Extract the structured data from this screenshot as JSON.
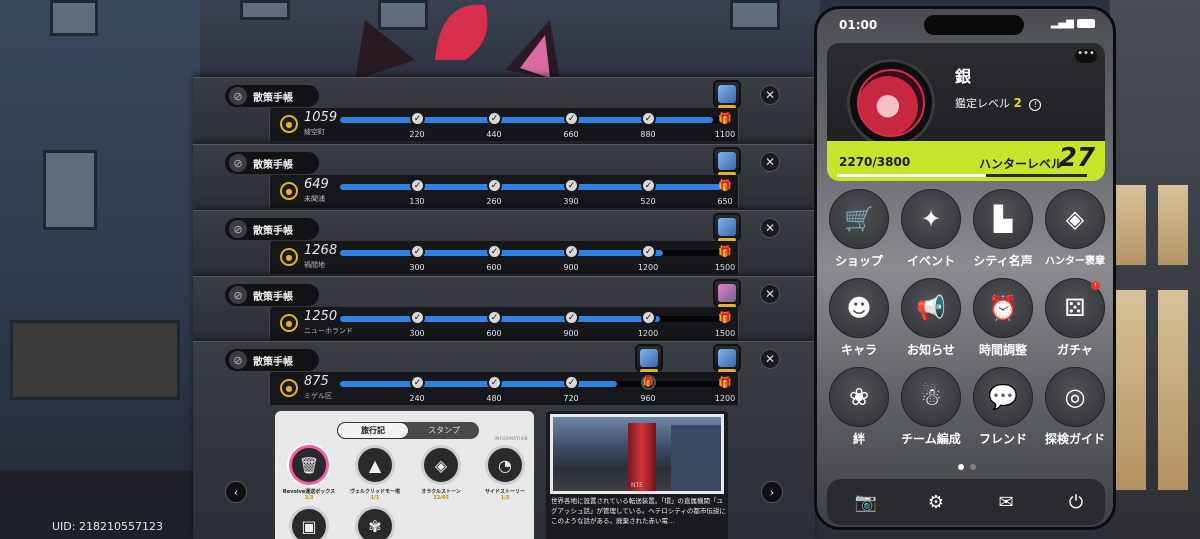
{
  "uid": "UID: 218210557123",
  "cards": [
    {
      "tag": "散策手帳",
      "score": "1059",
      "district": "綾空町",
      "fill_fraction": 0.97,
      "milestones": [
        "220",
        "440",
        "660",
        "880",
        "1100"
      ],
      "reward_tint": "blue"
    },
    {
      "tag": "散策手帳",
      "score": "649",
      "district": "未聞浦",
      "fill_fraction": 0.99,
      "milestones": [
        "130",
        "260",
        "390",
        "520",
        "650"
      ],
      "reward_tint": "blue"
    },
    {
      "tag": "散策手帳",
      "score": "1268",
      "district": "禍間地",
      "fill_fraction": 0.84,
      "milestones": [
        "300",
        "600",
        "900",
        "1200",
        "1500"
      ],
      "reward_tint": "blue"
    },
    {
      "tag": "散策手帳",
      "score": "1250",
      "district": "ニューホランド",
      "fill_fraction": 0.83,
      "milestones": [
        "300",
        "600",
        "900",
        "1200",
        "1500"
      ],
      "reward_tint": "pink"
    },
    {
      "tag": "散策手帳",
      "score": "875",
      "district": "ミゲル区",
      "fill_fraction": 0.72,
      "milestones": [
        "240",
        "480",
        "720",
        "960",
        "1200"
      ],
      "reward_tint": "blue"
    }
  ],
  "info": {
    "tabs": [
      "旅行記",
      "スタンプ"
    ],
    "active_tab": 0,
    "corner_tag": "INFORMATION",
    "stamps": [
      {
        "name": "Revolve運送ボックス",
        "count": "3/3",
        "icon": "trash-can-icon",
        "selected": true
      },
      {
        "name": "ヴェルクリッドモー塔",
        "count": "1/1",
        "icon": "tower-icon",
        "selected": false
      },
      {
        "name": "オラクルストーン",
        "count": "32/45",
        "icon": "crystal-icon",
        "selected": false
      },
      {
        "name": "サイドストーリー",
        "count": "1/3",
        "icon": "clock-spiral-icon",
        "selected": false
      },
      {
        "name": "",
        "count": "",
        "icon": "box-icon",
        "selected": false
      },
      {
        "name": "",
        "count": "",
        "icon": "knot-icon",
        "selected": false
      }
    ],
    "photo_caption": "NTE",
    "description": "世界各地に設置されている転送装置。「環」の直属機関「ユグアッシュ話」が管理している。ヘテロシティの都市伝説にこのような話がある。廃棄された赤い電…"
  },
  "phone": {
    "time": "01:00",
    "more": "•••",
    "player_name": "銀",
    "appraise_label": "鑑定レベル",
    "appraise_level": "2",
    "exp_text": "2270/3800",
    "exp_fraction": 0.597,
    "hunter_label": "ハンターレベル",
    "hunter_level": "27",
    "apps": [
      {
        "label": "ショップ",
        "icon": "cart-icon"
      },
      {
        "label": "イベント",
        "icon": "film-sparkle-icon"
      },
      {
        "label": "シティ名声",
        "icon": "city-icon"
      },
      {
        "label": "ハンター褒章",
        "icon": "emblem-icon"
      },
      {
        "label": "キャラ",
        "icon": "character-icon"
      },
      {
        "label": "お知らせ",
        "icon": "megaphone-icon"
      },
      {
        "label": "時間調整",
        "icon": "alarm-clock-icon"
      },
      {
        "label": "ガチャ",
        "icon": "dice-icon"
      },
      {
        "label": "絆",
        "icon": "heart-flower-icon"
      },
      {
        "label": "チーム編成",
        "icon": "team-icon"
      },
      {
        "label": "フレンド",
        "icon": "chat-bubble-icon"
      },
      {
        "label": "探検ガイド",
        "icon": "compass-icon"
      }
    ],
    "page_count": 2,
    "active_page": 0,
    "dock": [
      "camera-icon",
      "gear-icon",
      "mail-icon",
      "power-icon"
    ]
  },
  "colors": {
    "progress_blue": "#2f83e5",
    "level_lime": "#c8e42a",
    "accent_gold": "#e5b128",
    "alert_red": "#e33333"
  }
}
